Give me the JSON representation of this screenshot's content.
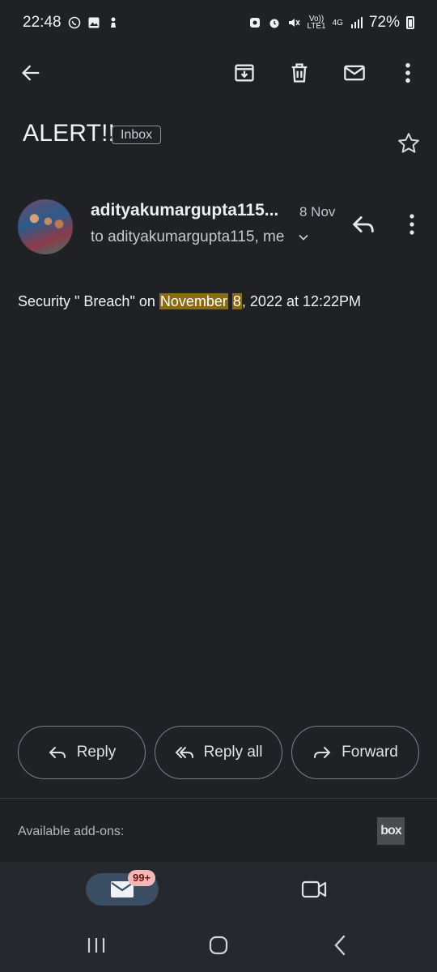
{
  "status_bar": {
    "time": "22:48",
    "network_small_top": "Vo))",
    "network_small_bottom": "LTE1",
    "network_4g": "4G",
    "battery": "72%"
  },
  "toolbar": {
    "back": "back-arrow-icon",
    "archive": "archive-icon",
    "delete": "delete-icon",
    "mark_unread": "mail-icon",
    "more": "more-vert-icon"
  },
  "email": {
    "subject": "ALERT!!",
    "label": "Inbox",
    "sender": "adityakumargupta115...",
    "date": "8 Nov",
    "recipients": "to adityakumargupta115, me",
    "body_prefix": "Security \" Breach\" on ",
    "body_highlight_1": "November",
    "body_space": " ",
    "body_highlight_2": "8",
    "body_suffix": ", 2022 at 12:22PM"
  },
  "actions": {
    "reply": "Reply",
    "reply_all": "Reply all",
    "forward": "Forward"
  },
  "addons": {
    "label": "Available add-ons:",
    "box": "box"
  },
  "bottom_nav": {
    "mail_badge": "99+"
  },
  "colors": {
    "background": "#1f2125",
    "highlight": "#8a6a12",
    "badge_bg": "#f4b7b7",
    "pill_bg": "#3b4d62"
  }
}
